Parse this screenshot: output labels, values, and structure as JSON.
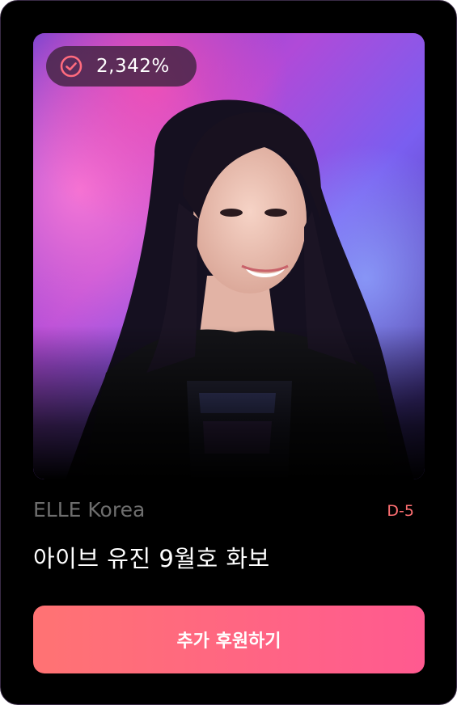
{
  "funding": {
    "progress_percent": "2,342%",
    "brand": "ELLE Korea",
    "deadline": "D-5",
    "title": "아이브 유진 9월호 화보",
    "cta_label": "추가 후원하기"
  },
  "icons": {
    "progress": "check-circle-icon"
  },
  "colors": {
    "accent": "#ff6f72",
    "cta_start": "#ff7373",
    "cta_end": "#ff5a90",
    "badge_bg": "#462646",
    "check": "#ff6b7e"
  }
}
